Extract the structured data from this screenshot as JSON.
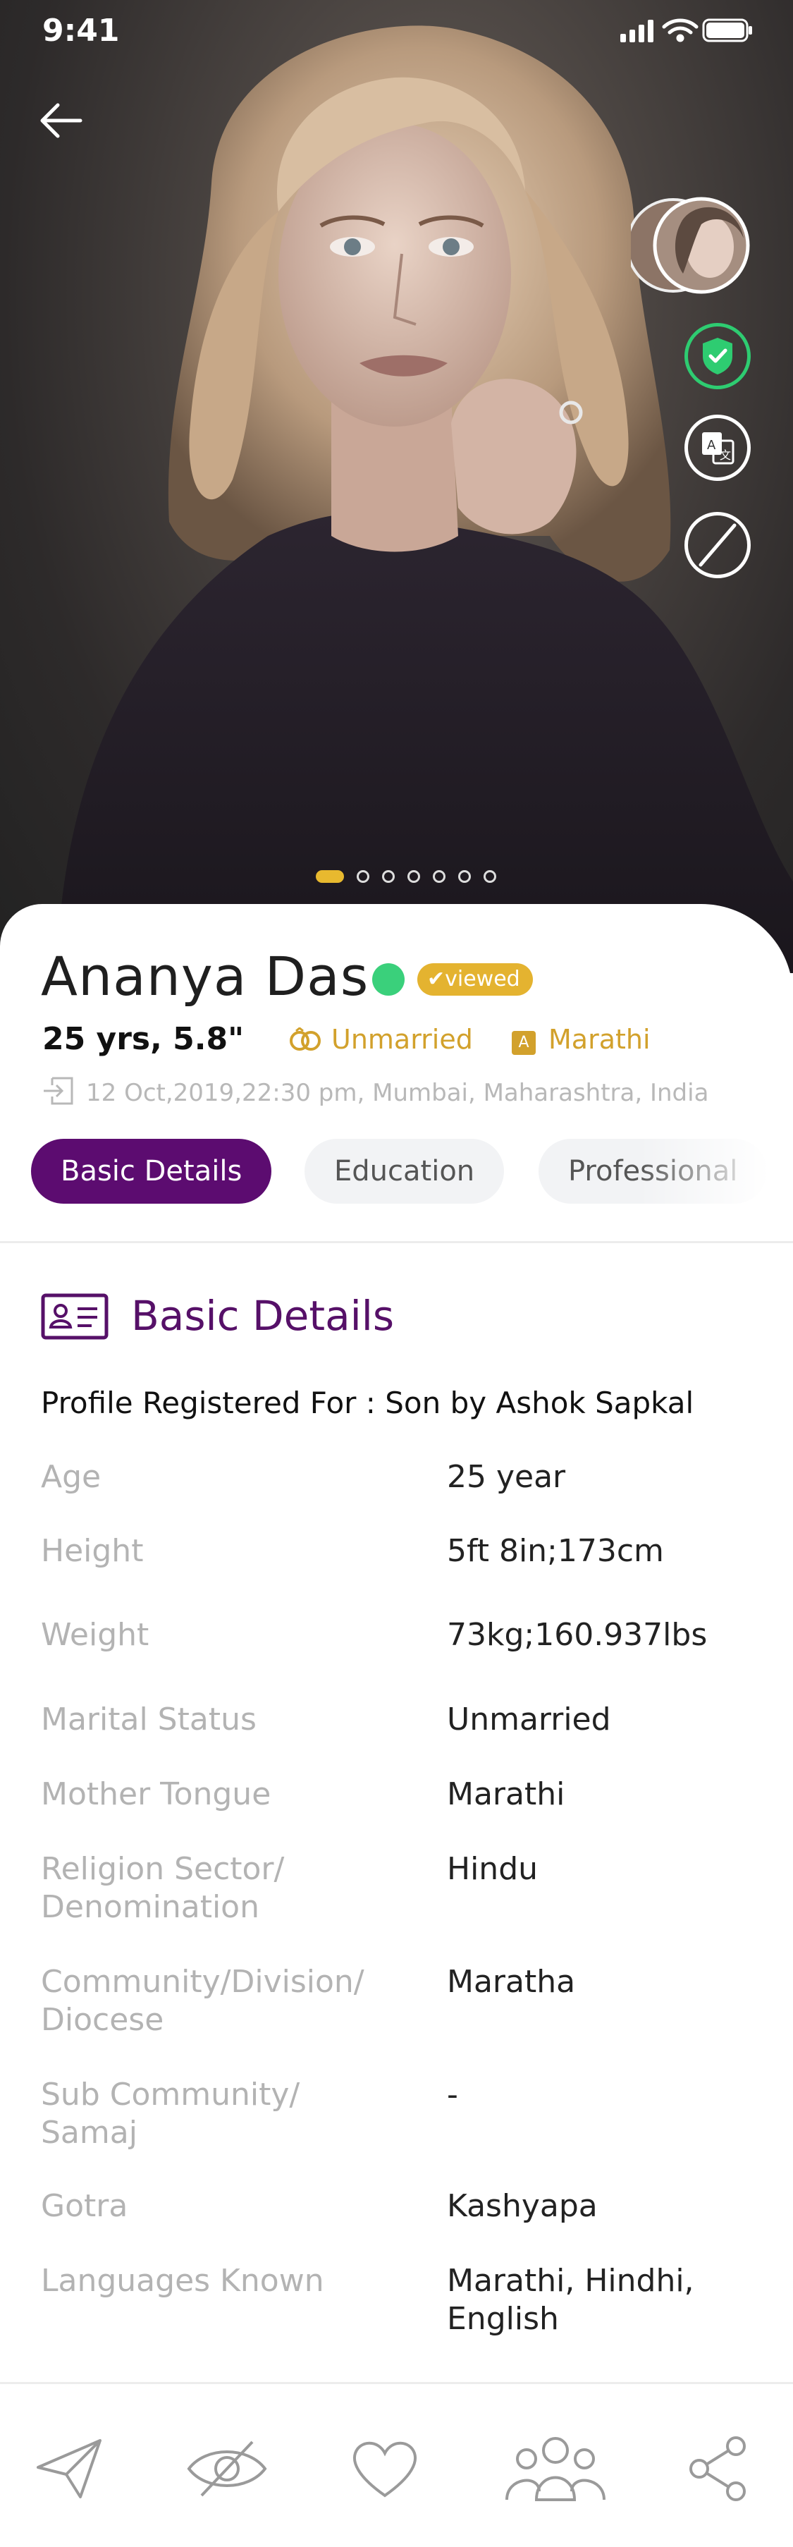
{
  "status_bar": {
    "time": "9:41"
  },
  "gallery": {
    "photo_count": 7,
    "active_index": 0
  },
  "profile": {
    "name": "Ananya Das",
    "viewed_badge": "viewed",
    "age_height": "25 yrs, 5.8\"",
    "marital_tag": "Unmarried",
    "language_tag": "Marathi",
    "language_tag_letter": "A",
    "registered_line": "12 Oct,2019,22:30 pm, Mumbai, Maharashtra, India"
  },
  "tabs": [
    {
      "label": "Basic Details",
      "active": true
    },
    {
      "label": "Education",
      "active": false
    },
    {
      "label": "Professional",
      "active": false
    }
  ],
  "section": {
    "title": "Basic Details",
    "registered_for": "Profile Registered For : Son by Ashok Sapkal",
    "rows": [
      {
        "label": "Age",
        "value": "25 year"
      },
      {
        "label": "Height",
        "value": "5ft 8in;173cm"
      },
      {
        "label": "Weight",
        "value": "73kg;160.937lbs"
      },
      {
        "label": "Marital Status",
        "value": "Unmarried"
      },
      {
        "label": "Mother Tongue",
        "value": "Marathi"
      },
      {
        "label": "Religion Sector/ Denomination",
        "value": "Hindu"
      },
      {
        "label": "Community/Division/ Diocese",
        "value": "Maratha"
      },
      {
        "label": "Sub Community/ Samaj",
        "value": "-"
      },
      {
        "label": "Gotra",
        "value": "Kashyapa"
      },
      {
        "label": "Languages Known",
        "value": "Marathi, Hindhi, English"
      }
    ]
  },
  "icons": {
    "side": [
      "verified-shield-icon",
      "translate-icon",
      "block-icon"
    ],
    "bottom_nav": [
      "send-icon",
      "hide-icon",
      "heart-icon",
      "group-icon",
      "share-icon"
    ]
  },
  "colors": {
    "accent_purple": "#5c0c70",
    "gold": "#e4b330",
    "online_green": "#3ad07b",
    "verified_green": "#2ecc71"
  }
}
